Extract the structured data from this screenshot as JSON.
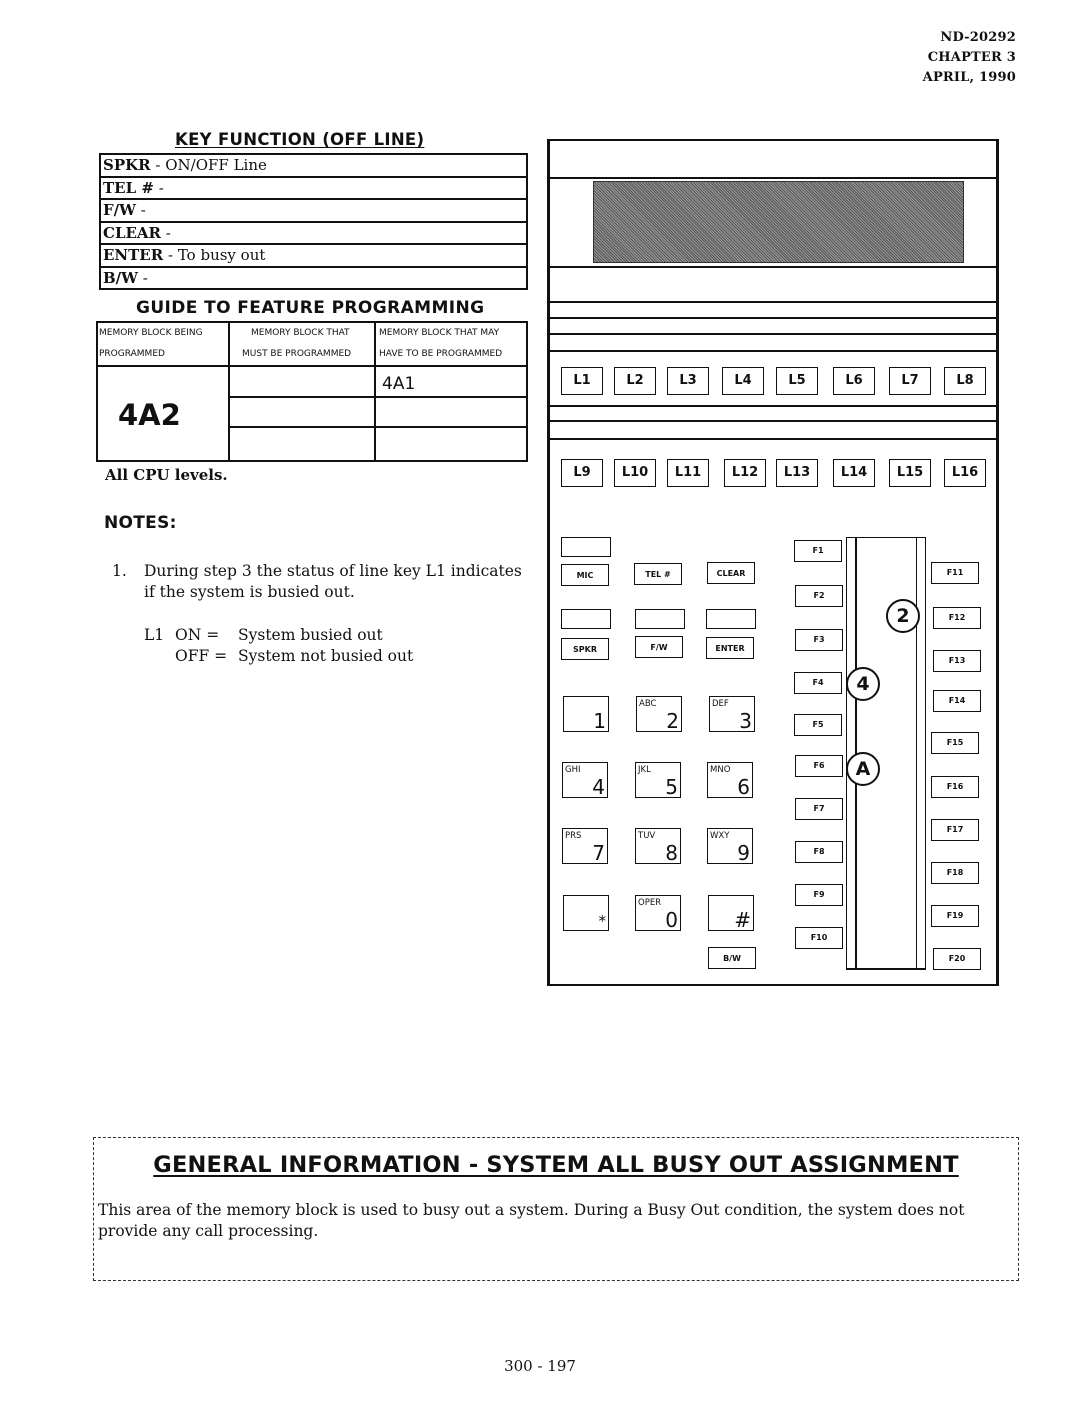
{
  "header": {
    "doc_number": "ND-20292",
    "chapter": "CHAPTER 3",
    "date": "APRIL, 1990"
  },
  "key_function": {
    "title": "KEY FUNCTION (OFF LINE)",
    "rows": [
      {
        "key": "SPKR",
        "desc": " -  ON/OFF Line"
      },
      {
        "key": "TEL #",
        "desc": " -"
      },
      {
        "key": "F/W",
        "desc": " -"
      },
      {
        "key": "CLEAR",
        "desc": " -"
      },
      {
        "key": "ENTER",
        "desc": " - To busy out"
      },
      {
        "key": "B/W",
        "desc": " -"
      }
    ]
  },
  "guide": {
    "title": "GUIDE TO FEATURE PROGRAMMING",
    "headers": [
      {
        "line1": "MEMORY BLOCK BEING",
        "line2": "PROGRAMMED"
      },
      {
        "line1": "MEMORY BLOCK THAT",
        "line2": "MUST BE PROGRAMMED"
      },
      {
        "line1": "MEMORY BLOCK THAT MAY",
        "line2": "HAVE TO BE PROGRAMMED"
      }
    ],
    "block_programmed": "4A2",
    "must_be_programmed": [
      "",
      "",
      ""
    ],
    "may_have_to_be_programmed": [
      "4A1",
      "",
      ""
    ]
  },
  "cpu_levels": "All CPU levels.",
  "notes": {
    "title": "NOTES:",
    "items": [
      {
        "number": "1.",
        "text_line1": "During step 3 the status of line key L1 indicates",
        "text_line2": "if the system is busied out.",
        "status_key": "L1",
        "on_label": "ON =",
        "on_text": "System busied out",
        "off_label": "OFF =",
        "off_text": "System not busied out"
      }
    ]
  },
  "phone": {
    "line_keys_row1": [
      "L1",
      "L2",
      "L3",
      "L4",
      "L5",
      "L6",
      "L7",
      "L8"
    ],
    "line_keys_row2": [
      "L9",
      "L10",
      "L11",
      "L12",
      "L13",
      "L14",
      "L15",
      "L16"
    ],
    "function_buttons": [
      "MIC",
      "TEL #",
      "CLEAR",
      "SPKR",
      "F/W",
      "ENTER",
      "B/W"
    ],
    "dial_keys": [
      {
        "letters": "",
        "digit": "1"
      },
      {
        "letters": "ABC",
        "digit": "2"
      },
      {
        "letters": "DEF",
        "digit": "3"
      },
      {
        "letters": "GHI",
        "digit": "4"
      },
      {
        "letters": "JKL",
        "digit": "5"
      },
      {
        "letters": "MNO",
        "digit": "6"
      },
      {
        "letters": "PRS",
        "digit": "7"
      },
      {
        "letters": "TUV",
        "digit": "8"
      },
      {
        "letters": "WXY",
        "digit": "9"
      },
      {
        "letters": "",
        "digit": "*"
      },
      {
        "letters": "OPER",
        "digit": "0"
      },
      {
        "letters": "",
        "digit": "#"
      }
    ],
    "f_keys_left": [
      "F1",
      "F2",
      "F3",
      "F4",
      "F5",
      "F6",
      "F7",
      "F8",
      "F9",
      "F10"
    ],
    "f_keys_right": [
      "F11",
      "F12",
      "F13",
      "F14",
      "F15",
      "F16",
      "F17",
      "F18",
      "F19",
      "F20"
    ],
    "callouts": [
      "2",
      "4",
      "A"
    ]
  },
  "general_info": {
    "title": "GENERAL INFORMATION  -  SYSTEM ALL BUSY OUT ASSIGNMENT",
    "text_line1": "This area of the memory block is used to busy out a system.  During a Busy Out condition, the system does not",
    "text_line2": "provide any call processing."
  },
  "page_number": "300 - 197"
}
